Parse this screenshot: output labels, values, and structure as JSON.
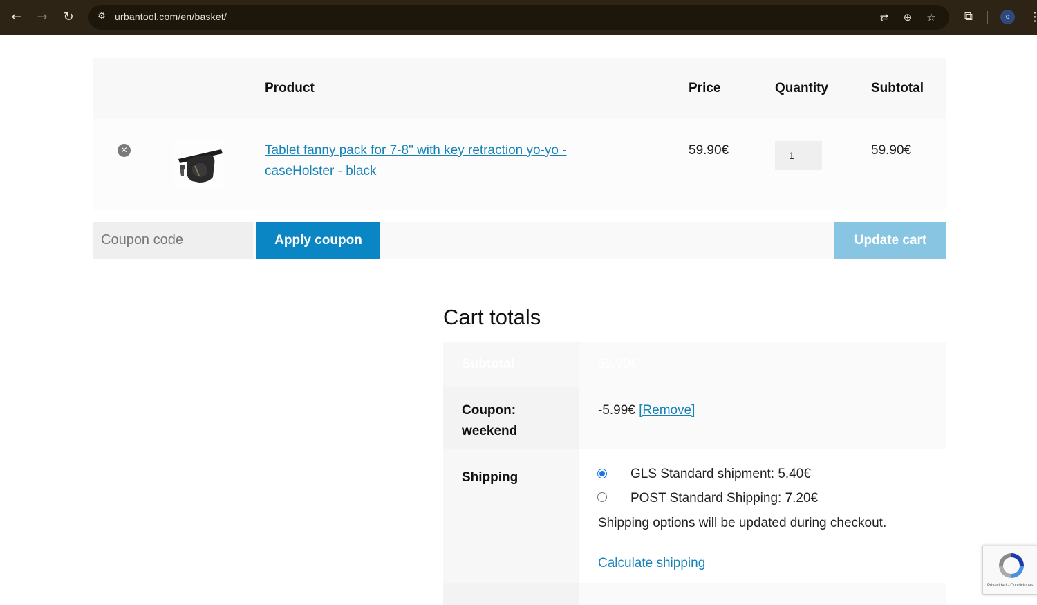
{
  "browser": {
    "url": "urbantool.com/en/basket/",
    "profile_initial": "o",
    "icons": [
      "back-arrow-icon",
      "forward-arrow-icon",
      "reload-icon",
      "site-settings-icon",
      "translate-icon",
      "zoom-icon",
      "bookmark-star-icon",
      "extensions-icon",
      "kebab-menu-icon"
    ]
  },
  "cart": {
    "headers": {
      "product": "Product",
      "price": "Price",
      "quantity": "Quantity",
      "subtotal": "Subtotal"
    },
    "items": [
      {
        "name": "Tablet fanny pack for 7-8\" with key retraction yo-yo - caseHolster - black",
        "price": "59.90€",
        "quantity": "1",
        "subtotal": "59.90€"
      }
    ],
    "coupon_placeholder": "Coupon code",
    "apply_coupon_label": "Apply coupon",
    "update_cart_label": "Update cart"
  },
  "totals": {
    "title": "Cart totals",
    "subtotal_label": "Subtotal",
    "subtotal_value": "59.90€",
    "coupon_label": "Coupon: weekend",
    "coupon_value": "-5.99€",
    "coupon_remove": "[Remove]",
    "shipping_label": "Shipping",
    "shipping_options": [
      {
        "label": "GLS Standard shipment: 5.40€",
        "selected": true
      },
      {
        "label": "POST Standard Shipping: 7.20€",
        "selected": false
      }
    ],
    "shipping_note": "Shipping options will be updated during checkout.",
    "calculate_shipping": "Calculate shipping"
  },
  "recaptcha": {
    "terms": "Privacidad - Condiciones"
  },
  "colors": {
    "browser_bar": "#2e2415",
    "primary_button": "#0a86c4",
    "disabled_button": "#87c5e2",
    "link": "#1583b8"
  }
}
